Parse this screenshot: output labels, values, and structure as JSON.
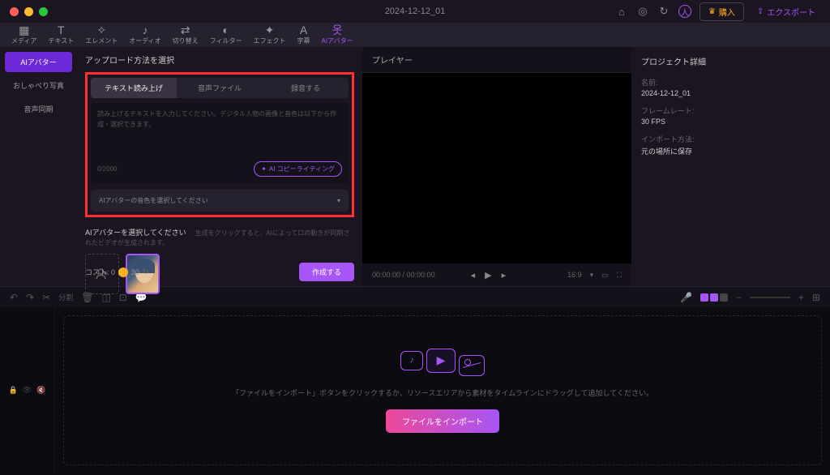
{
  "titlebar": {
    "doc_title": "2024-12-12_01",
    "buy": "購入",
    "export": "エクスポート"
  },
  "toolbar": {
    "items": [
      {
        "label": "メディア"
      },
      {
        "label": "テキスト"
      },
      {
        "label": "エレメント"
      },
      {
        "label": "オーディオ"
      },
      {
        "label": "切り替え"
      },
      {
        "label": "フィルター"
      },
      {
        "label": "エフェクト"
      },
      {
        "label": "字幕"
      },
      {
        "label": "AIアバター"
      }
    ]
  },
  "sidebar": {
    "tabs": [
      {
        "label": "AIアバター"
      },
      {
        "label": "おしゃべり写真"
      },
      {
        "label": "音声同期"
      }
    ]
  },
  "content": {
    "upload_title": "アップロード方法を選択",
    "method_tabs": [
      {
        "label": "テキスト読み上げ"
      },
      {
        "label": "音声ファイル"
      },
      {
        "label": "録音する"
      }
    ],
    "placeholder": "読み上げるテキストを入力してください。デジタル人物の画像と音色は以下から作成・選択できます。",
    "char_count": "0/2000",
    "ai_copy": "AI コピーライティング",
    "voice_select": "AIアバターの音色を選択してください",
    "avatar_label": "AIアバターを選択してください",
    "avatar_hint": "生成をクリックすると、AIによって口の動きが同期されたビデオが生成されます。",
    "cost_label": "コスト: 0",
    "cost_value": "30",
    "create": "作成する"
  },
  "player": {
    "title": "プレイヤー",
    "timecode": "00:00:00 / 00:00:00",
    "ratio": "16:9"
  },
  "details": {
    "header": "プロジェクト詳細",
    "rows": [
      {
        "label": "名前:",
        "value": "2024-12-12_01"
      },
      {
        "label": "フレームレート:",
        "value": "30 FPS"
      },
      {
        "label": "インポート方法:",
        "value": "元の場所に保存"
      }
    ]
  },
  "timeline_bar": {
    "split": "分割"
  },
  "timeline": {
    "hint": "「ファイルをインポート」ボタンをクリックするか、リソースエリアから素材をタイムラインにドラッグして追加してください。",
    "import_btn": "ファイルをインポート"
  }
}
